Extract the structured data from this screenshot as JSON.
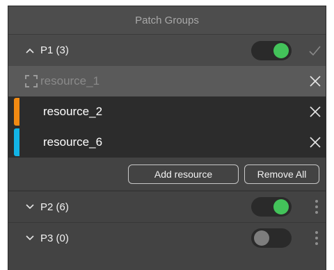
{
  "panel": {
    "title": "Patch Groups"
  },
  "groups": [
    {
      "label": "P1 (3)",
      "expanded": true,
      "enabled": true,
      "placeholder": "resource_1",
      "resources": [
        {
          "label": "resource_2",
          "color": "#f28a12"
        },
        {
          "label": "resource_6",
          "color": "#12b4e6"
        }
      ],
      "actions": {
        "add": "Add resource",
        "remove": "Remove All"
      }
    },
    {
      "label": "P2 (6)",
      "expanded": false,
      "enabled": true
    },
    {
      "label": "P3 (0)",
      "expanded": false,
      "enabled": false
    }
  ],
  "colors": {
    "toggle_on": "#43c35a",
    "panel_bg": "#434343",
    "row_bg": "#2c2c2c"
  },
  "icons": [
    "chevron-up-icon",
    "chevron-down-icon",
    "check-icon",
    "close-icon",
    "more-vertical-icon",
    "placeholder-frame-icon"
  ]
}
